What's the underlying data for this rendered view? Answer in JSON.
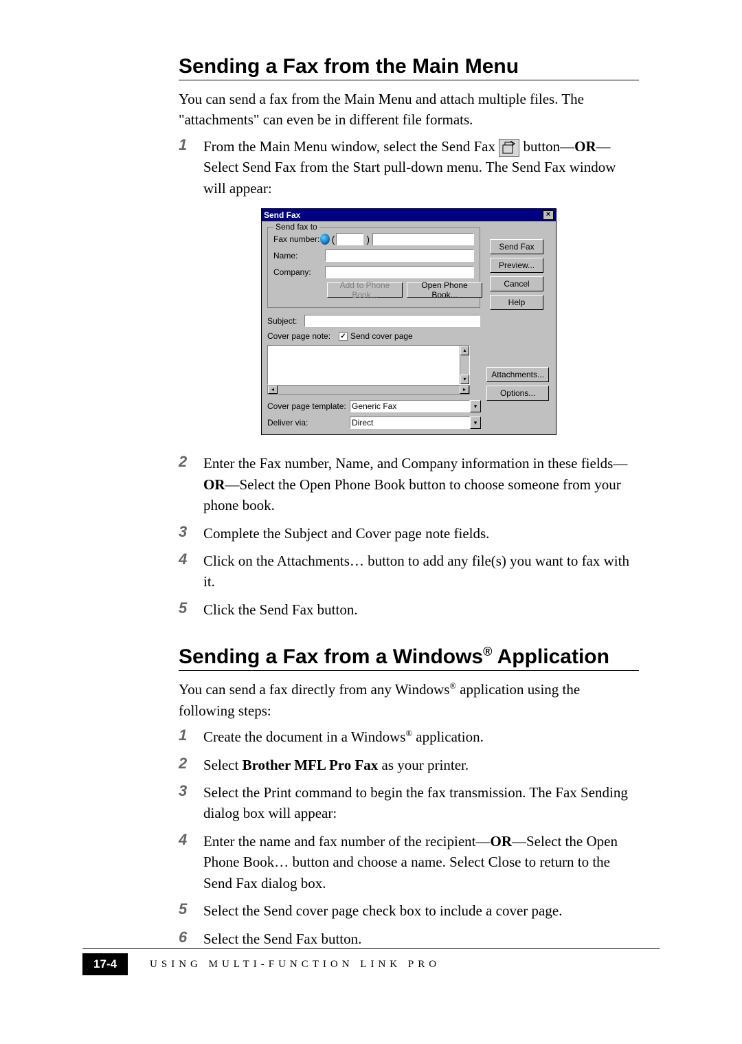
{
  "section1": {
    "heading": "Sending a Fax from the Main Menu",
    "intro": "You can send a fax from the Main Menu and attach multiple files. The \"attachments\" can even be in different file formats.",
    "step1_a": "From the Main Menu window, select the Send Fax ",
    "step1_b": " button—",
    "step1_or": "OR",
    "step1_c": "—Select Send Fax  from the Start pull-down menu.  The Send Fax window will appear:",
    "step2_a": "Enter the Fax number, Name, and Company information in these fields—",
    "step2_or": "OR",
    "step2_b": "—Select the Open Phone Book button to choose someone from your phone book.",
    "step3": "Complete the Subject and Cover page note fields.",
    "step4": "Click on the Attachments… button to add any file(s) you want to fax with it.",
    "step5": "Click the Send Fax button."
  },
  "nums": {
    "n1": "1",
    "n2": "2",
    "n3": "3",
    "n4": "4",
    "n5": "5",
    "n6": "6"
  },
  "dialog": {
    "title": "Send Fax",
    "close": "×",
    "group_title": "Send fax to",
    "fax_number_label": "Fax number:",
    "name_label": "Name:",
    "company_label": "Company:",
    "paren_open": "(",
    "paren_close": ")",
    "add_phone": "Add to Phone Book...",
    "open_phone": "Open Phone Book...",
    "send_fax": "Send Fax",
    "preview": "Preview...",
    "cancel": "Cancel",
    "help": "Help",
    "subject_label": "Subject:",
    "cover_note_label": "Cover page note:",
    "send_cover": "Send cover page",
    "checkmark": "✓",
    "attachments": "Attachments...",
    "options": "Options...",
    "template_label": "Cover page template:",
    "template_value": "Generic Fax",
    "deliver_label": "Deliver via:",
    "deliver_value": "Direct",
    "up": "▴",
    "down": "▾",
    "left": "◂",
    "right": "▸"
  },
  "section2": {
    "heading_a": "Sending a Fax from a Windows",
    "heading_sup": "®",
    "heading_b": " Application",
    "intro_a": "You can send a fax directly from any Windows",
    "intro_sup": "®",
    "intro_b": " application using the following steps:",
    "step1_a": "Create the document in a Windows",
    "step1_sup": "®",
    "step1_b": " application.",
    "step2_a": "Select ",
    "step2_bold": "Brother MFL Pro Fax",
    "step2_b": " as your printer.",
    "step3": "Select the Print command to begin the fax transmission.  The Fax Sending dialog box will appear:",
    "step4_a": "Enter the name and fax number of the recipient—",
    "step4_or": "OR",
    "step4_b": "—Select the Open Phone Book… button and choose a name. Select Close to return to the Send Fax dialog box.",
    "step5": "Select the Send cover page check box to include a cover page.",
    "step6": "Select the Send Fax button."
  },
  "footer": {
    "page": "17-4",
    "chapter": "USING MULTI-FUNCTION LINK PRO"
  }
}
